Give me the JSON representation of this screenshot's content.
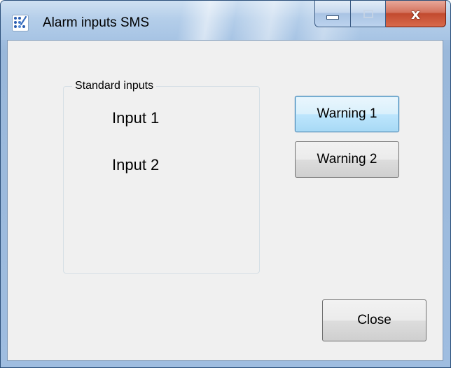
{
  "window": {
    "title": "Alarm inputs SMS",
    "close_glyph": "x"
  },
  "groupbox": {
    "legend": "Standard inputs",
    "inputs": [
      "Input 1",
      "Input 2"
    ]
  },
  "buttons": {
    "warning1": "Warning 1",
    "warning2": "Warning 2",
    "close": "Close"
  },
  "icons": {
    "app": "app-dots-icon",
    "minimize": "minimize-icon",
    "maximize": "maximize-icon",
    "close": "close-icon"
  },
  "colors": {
    "frame": "#a6c2e2",
    "client_bg": "#f0f0f0",
    "close_button": "#c24a2f",
    "focus_border": "#3c7fb1"
  }
}
